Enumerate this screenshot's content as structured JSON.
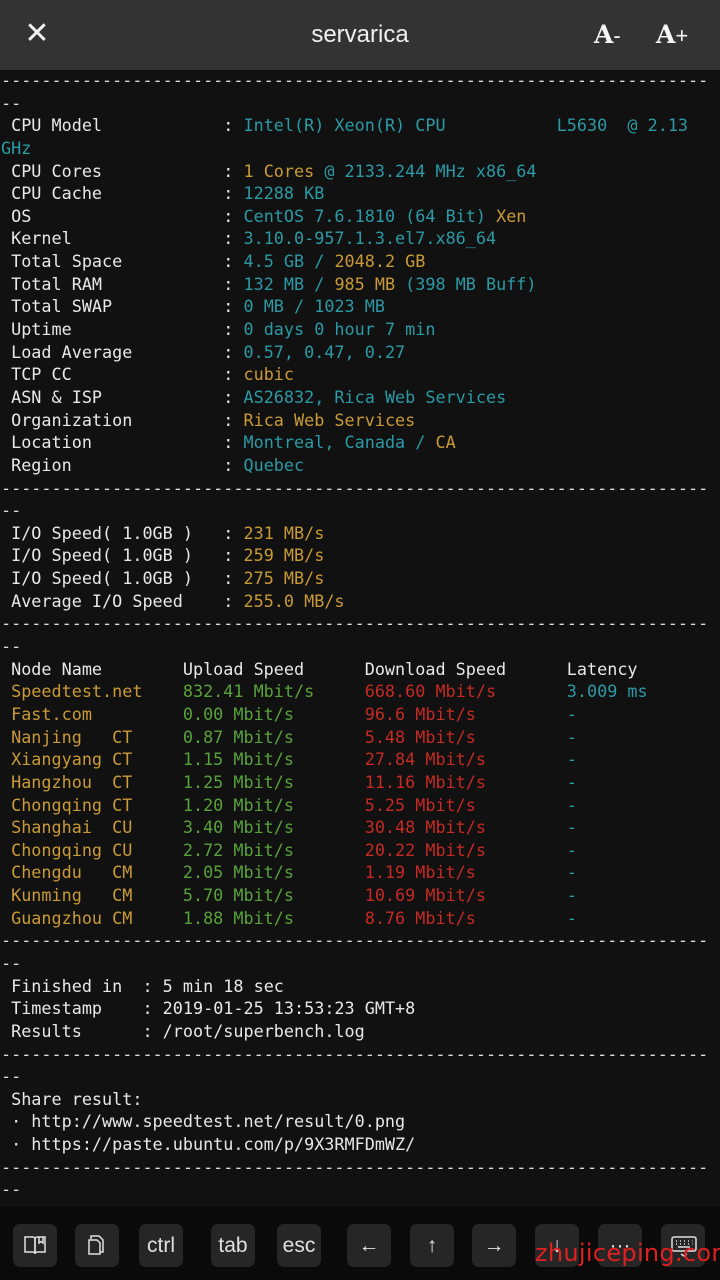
{
  "header": {
    "title": "servarica",
    "close_label": "✕",
    "font_decrease": {
      "letter": "A",
      "sign": "-"
    },
    "font_increase": {
      "letter": "A",
      "sign": "+"
    }
  },
  "separator": {
    "line": "----------------------------------------------------------------------",
    "tail": "--"
  },
  "system_info": [
    {
      "label": " CPU Model            ",
      "sep": ": ",
      "parts": [
        {
          "t": "Intel(R) Xeon(R) CPU           L5630  @ 2.13",
          "c": "c"
        }
      ]
    },
    {
      "label": "",
      "sep": "",
      "parts": [
        {
          "t": "GHz",
          "c": "c"
        }
      ]
    },
    {
      "label": " CPU Cores            ",
      "sep": ": ",
      "parts": [
        {
          "t": "1 Cores",
          "c": "y"
        },
        {
          "t": " @ 2133.244 MHz x86_64",
          "c": "c"
        }
      ]
    },
    {
      "label": " CPU Cache            ",
      "sep": ": ",
      "parts": [
        {
          "t": "12288 KB",
          "c": "c"
        }
      ]
    },
    {
      "label": " OS                   ",
      "sep": ": ",
      "parts": [
        {
          "t": "CentOS 7.6.1810 (64 Bit)",
          "c": "c"
        },
        {
          "t": " Xen",
          "c": "y"
        }
      ]
    },
    {
      "label": " Kernel               ",
      "sep": ": ",
      "parts": [
        {
          "t": "3.10.0-957.1.3.el7.x86_64",
          "c": "c"
        }
      ]
    },
    {
      "label": " Total Space          ",
      "sep": ": ",
      "parts": [
        {
          "t": "4.5 GB / ",
          "c": "c"
        },
        {
          "t": "2048.2 GB",
          "c": "y"
        }
      ]
    },
    {
      "label": " Total RAM            ",
      "sep": ": ",
      "parts": [
        {
          "t": "132 MB / ",
          "c": "c"
        },
        {
          "t": "985 MB",
          "c": "y"
        },
        {
          "t": " (398 MB Buff)",
          "c": "c"
        }
      ]
    },
    {
      "label": " Total SWAP           ",
      "sep": ": ",
      "parts": [
        {
          "t": "0 MB / 1023 MB",
          "c": "c"
        }
      ]
    },
    {
      "label": " Uptime               ",
      "sep": ": ",
      "parts": [
        {
          "t": "0 days 0 hour 7 min",
          "c": "c"
        }
      ]
    },
    {
      "label": " Load Average         ",
      "sep": ": ",
      "parts": [
        {
          "t": "0.57, 0.47, 0.27",
          "c": "c"
        }
      ]
    },
    {
      "label": " TCP CC               ",
      "sep": ": ",
      "parts": [
        {
          "t": "cubic",
          "c": "y"
        }
      ]
    },
    {
      "label": " ASN & ISP            ",
      "sep": ": ",
      "parts": [
        {
          "t": "AS26832, Rica Web Services",
          "c": "c"
        }
      ]
    },
    {
      "label": " Organization         ",
      "sep": ": ",
      "parts": [
        {
          "t": "Rica Web Services",
          "c": "y"
        }
      ]
    },
    {
      "label": " Location             ",
      "sep": ": ",
      "parts": [
        {
          "t": "Montreal, Canada / ",
          "c": "c"
        },
        {
          "t": "CA",
          "c": "y"
        }
      ]
    },
    {
      "label": " Region               ",
      "sep": ": ",
      "parts": [
        {
          "t": "Quebec",
          "c": "c"
        }
      ]
    }
  ],
  "io_speed": [
    {
      "label": " I/O Speed( 1.0GB )   ",
      "sep": ": ",
      "parts": [
        {
          "t": "231 MB/s",
          "c": "y"
        }
      ]
    },
    {
      "label": " I/O Speed( 1.0GB )   ",
      "sep": ": ",
      "parts": [
        {
          "t": "259 MB/s",
          "c": "y"
        }
      ]
    },
    {
      "label": " I/O Speed( 1.0GB )   ",
      "sep": ": ",
      "parts": [
        {
          "t": "275 MB/s",
          "c": "y"
        }
      ]
    },
    {
      "label": " Average I/O Speed    ",
      "sep": ": ",
      "parts": [
        {
          "t": "255.0 MB/s",
          "c": "y"
        }
      ]
    }
  ],
  "speedtest": {
    "headers": [
      "Node Name",
      "Upload Speed",
      "Download Speed",
      "Latency"
    ],
    "rows": [
      {
        "node": "Speedtest.net",
        "upload": "832.41 Mbit/s",
        "download": "668.60 Mbit/s",
        "latency": "3.009 ms"
      },
      {
        "node": "Fast.com",
        "upload": "0.00 Mbit/s",
        "download": "96.6 Mbit/s",
        "latency": "-"
      },
      {
        "node": "Nanjing   CT",
        "upload": "0.87 Mbit/s",
        "download": "5.48 Mbit/s",
        "latency": "-"
      },
      {
        "node": "Xiangyang CT",
        "upload": "1.15 Mbit/s",
        "download": "27.84 Mbit/s",
        "latency": "-"
      },
      {
        "node": "Hangzhou  CT",
        "upload": "1.25 Mbit/s",
        "download": "11.16 Mbit/s",
        "latency": "-"
      },
      {
        "node": "Chongqing CT",
        "upload": "1.20 Mbit/s",
        "download": "5.25 Mbit/s",
        "latency": "-"
      },
      {
        "node": "Shanghai  CU",
        "upload": "3.40 Mbit/s",
        "download": "30.48 Mbit/s",
        "latency": "-"
      },
      {
        "node": "Chongqing CU",
        "upload": "2.72 Mbit/s",
        "download": "20.22 Mbit/s",
        "latency": "-"
      },
      {
        "node": "Chengdu   CM",
        "upload": "2.05 Mbit/s",
        "download": "1.19 Mbit/s",
        "latency": "-"
      },
      {
        "node": "Kunming   CM",
        "upload": "5.70 Mbit/s",
        "download": "10.69 Mbit/s",
        "latency": "-"
      },
      {
        "node": "Guangzhou CM",
        "upload": "1.88 Mbit/s",
        "download": "8.76 Mbit/s",
        "latency": "-"
      }
    ]
  },
  "summary": [
    {
      "label": " Finished in  ",
      "sep": ": ",
      "parts": [
        {
          "t": "5 min 18 sec",
          "c": "w"
        }
      ]
    },
    {
      "label": " Timestamp    ",
      "sep": ": ",
      "parts": [
        {
          "t": "2019-01-25 13:53:23 GMT+8",
          "c": "w"
        }
      ]
    },
    {
      "label": " Results      ",
      "sep": ": ",
      "parts": [
        {
          "t": "/root/superbench.log",
          "c": "w"
        }
      ]
    }
  ],
  "share": {
    "title": " Share result:",
    "links": [
      " · http://www.speedtest.net/result/0.png",
      " · https://paste.ubuntu.com/p/9X3RMFDmWZ/"
    ]
  },
  "toolbar": {
    "keys": [
      {
        "name": "book-key",
        "icon": "book-icon",
        "label": ""
      },
      {
        "name": "copy-key",
        "icon": "copy-icon",
        "label": ""
      },
      {
        "name": "ctrl-key",
        "label": "ctrl"
      },
      {
        "name": "tab-key",
        "label": "tab"
      },
      {
        "name": "esc-key",
        "label": "esc"
      },
      {
        "name": "left-arrow-key",
        "label": "←"
      },
      {
        "name": "up-arrow-key",
        "label": "↑"
      },
      {
        "name": "right-arrow-key",
        "label": "→"
      },
      {
        "name": "down-arrow-key",
        "label": "↓"
      },
      {
        "name": "more-key",
        "label": "···"
      },
      {
        "name": "keyboard-key",
        "icon": "keyboard-icon",
        "label": ""
      }
    ]
  },
  "watermark": "zhujiceping.com",
  "colors": {
    "cyan": "#2b9aa5",
    "yellow": "#c99a36",
    "green": "#58a23a",
    "red": "#c52a23",
    "background": "#111111",
    "header": "#333333"
  }
}
